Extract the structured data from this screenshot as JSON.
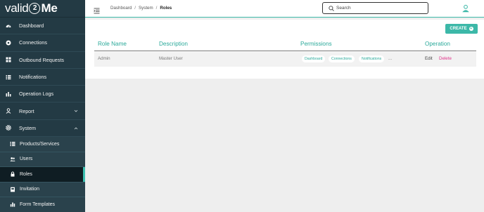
{
  "logo": {
    "part1": "valid",
    "part2": "2",
    "part3": "Me"
  },
  "sidebar": {
    "items": [
      {
        "label": "Dashboard"
      },
      {
        "label": "Connections"
      },
      {
        "label": "Outbound Requests"
      },
      {
        "label": "Notifications"
      },
      {
        "label": "Operation Logs"
      },
      {
        "label": "Report"
      },
      {
        "label": "System"
      }
    ],
    "subitems": [
      {
        "label": "Products/Services"
      },
      {
        "label": "Users"
      },
      {
        "label": "Roles"
      },
      {
        "label": "Invitation"
      },
      {
        "label": "Form Templates"
      }
    ]
  },
  "breadcrumb": {
    "first": "Dashboard",
    "second": "System",
    "current": "Roles",
    "separator": "/"
  },
  "search": {
    "placeholder": "Search"
  },
  "toolbar": {
    "create_label": "CREATE",
    "create_icon": "+"
  },
  "table": {
    "headers": {
      "role_name": "Role Name",
      "description": "Description",
      "permissions": "Permissions",
      "operation": "Operation"
    },
    "rows": [
      {
        "role_name": "Admin",
        "description": "Master User",
        "permissions": [
          "Dashboard",
          "Connections",
          "Notifications"
        ],
        "more": "...",
        "edit": "Edit",
        "delete": "Delete"
      }
    ]
  },
  "colors": {
    "sidebar": "#233a44",
    "accent": "#3cb8a8",
    "delete": "#e0348a"
  }
}
